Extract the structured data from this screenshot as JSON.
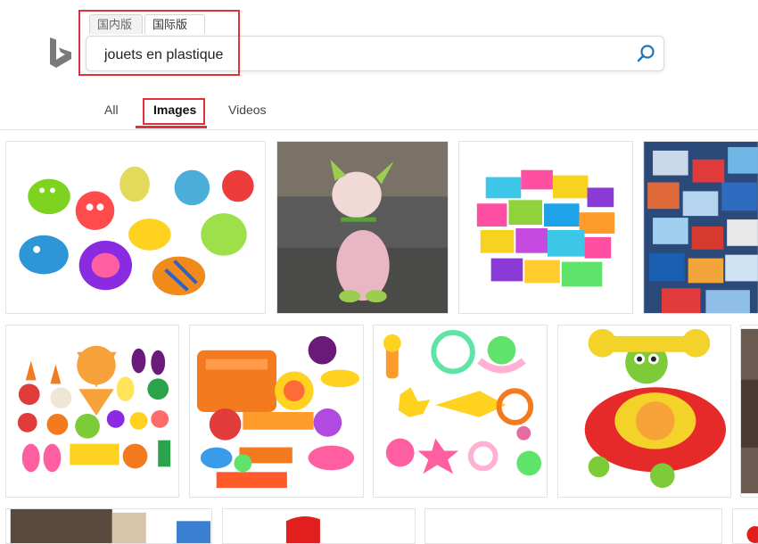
{
  "logo": {
    "icon": "bing-logo-icon"
  },
  "region_tabs": [
    "国内版",
    "国际版"
  ],
  "search": {
    "query": "jouets en plastique",
    "button_icon": "search-icon"
  },
  "nav": {
    "tabs": [
      "All",
      "Images",
      "Videos"
    ],
    "active": "Images"
  },
  "accent_color": "#e0313c",
  "results": [
    {
      "row": 1,
      "subject": "colorful plastic bath animal toys"
    },
    {
      "row": 1,
      "subject": "pink ceramic cat figurine"
    },
    {
      "row": 1,
      "subject": "colorful plastic building blocks"
    },
    {
      "row": 1,
      "subject": "translucent plastic blocks"
    },
    {
      "row": 2,
      "subject": "plastic toy fruits and vegetables"
    },
    {
      "row": 2,
      "subject": "orange plastic kitchen play set"
    },
    {
      "row": 2,
      "subject": "baby rattles and teethers"
    },
    {
      "row": 2,
      "subject": "red toy telephone"
    },
    {
      "row": 2,
      "subject": "partial image"
    },
    {
      "row": 3,
      "subject": "partial image"
    },
    {
      "row": 3,
      "subject": "partial image"
    },
    {
      "row": 3,
      "subject": "partial image"
    },
    {
      "row": 3,
      "subject": "partial image"
    }
  ]
}
